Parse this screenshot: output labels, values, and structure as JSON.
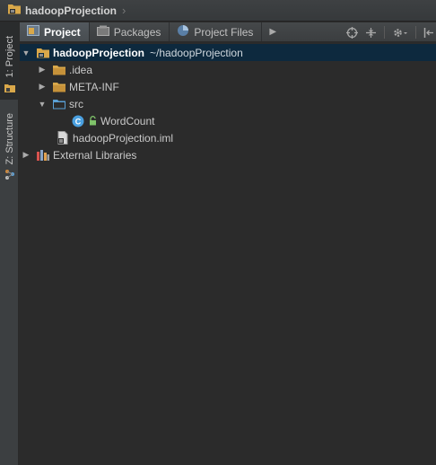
{
  "navbar": {
    "crumb_label": "hadoopProjection",
    "crumb_icon": "module-folder-icon"
  },
  "stripe": {
    "project_label": "1: Project",
    "structure_label": "Z: Structure"
  },
  "tabs": [
    {
      "label": "Project",
      "icon": "project-icon",
      "active": true
    },
    {
      "label": "Packages",
      "icon": "packages-icon",
      "active": false
    },
    {
      "label": "Project Files",
      "icon": "project-files-icon",
      "active": false
    }
  ],
  "toolbar": {
    "locate_icon": "target-icon",
    "collapse_icon": "collapse-all-icon",
    "settings_icon": "gear-icon",
    "hide_icon": "hide-panel-icon"
  },
  "tree": {
    "root": {
      "label": "hadoopProjection",
      "path": "~/hadoopProjection",
      "expanded": true
    },
    "idea": {
      "label": ".idea",
      "expanded": false
    },
    "metainf": {
      "label": "META-INF",
      "expanded": false
    },
    "src": {
      "label": "src",
      "expanded": true
    },
    "wordcount": {
      "label": "WordCount",
      "class_badge": "C"
    },
    "iml": {
      "label": "hadoopProjection.iml"
    },
    "libraries": {
      "label": "External Libraries",
      "expanded": false
    }
  },
  "colors": {
    "background": "#2b2b2b",
    "selection": "#0d293e",
    "folder": "#d9a84a",
    "source_folder": "#5a9fd4",
    "class_badge": "#4aa0e0"
  }
}
